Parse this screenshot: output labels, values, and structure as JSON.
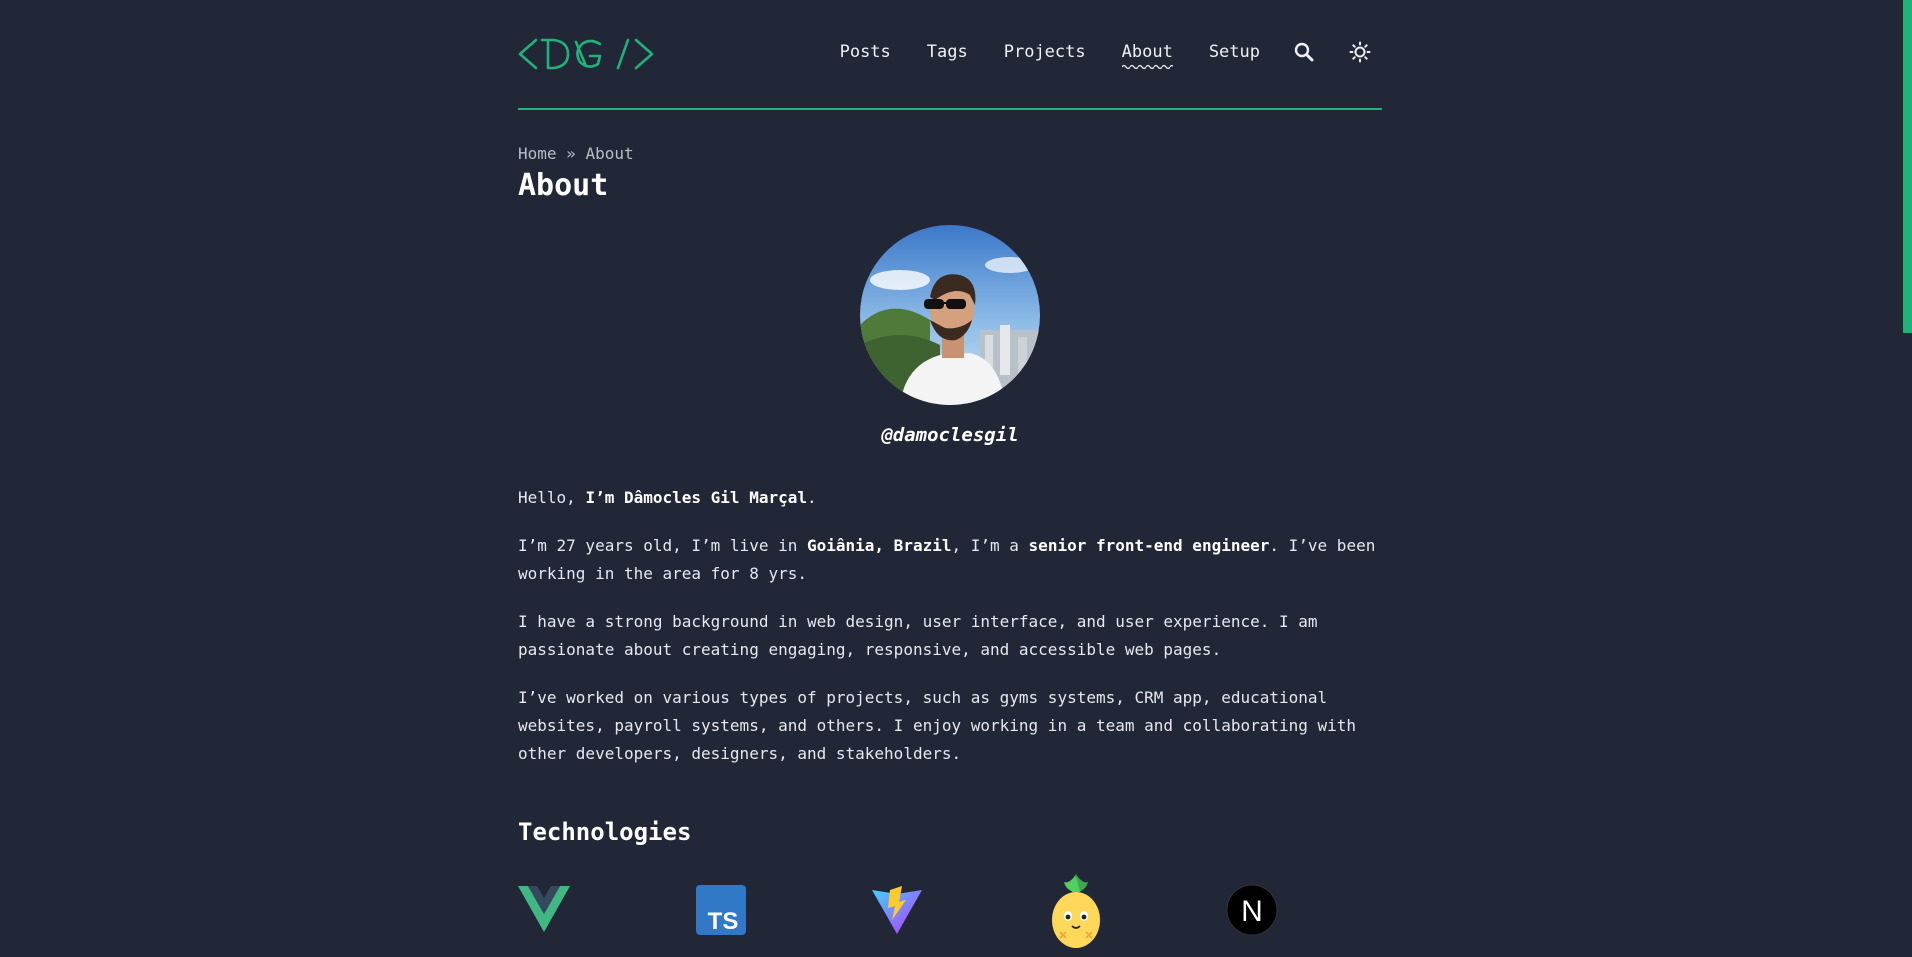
{
  "header": {
    "logo_text": "<DG/>",
    "nav": [
      {
        "label": "Posts"
      },
      {
        "label": "Tags"
      },
      {
        "label": "Projects"
      },
      {
        "label": "About"
      },
      {
        "label": "Setup"
      }
    ],
    "active_nav": "About",
    "accent_color": "#1fb27a"
  },
  "breadcrumb": {
    "home": "Home",
    "separator": "»",
    "current": "About"
  },
  "page": {
    "title": "About",
    "handle": "@damoclesgil"
  },
  "content": {
    "p1": {
      "a": "Hello, ",
      "b": "I’m Dâmocles Gil Marçal",
      "c": "."
    },
    "p2": {
      "a": "I’m 27 years old, I’m live in ",
      "b": "Goiânia, Brazil",
      "c": ", I’m a ",
      "d": "senior front-end engineer",
      "e": ". I’ve been working in the area for 8 yrs."
    },
    "p3": "I have a strong background in web design, user interface, and user experience. I am passionate about creating engaging, responsive, and accessible web pages.",
    "p4": "I’ve worked on various types of projects, such as gyms systems, CRM app, educational websites, payroll systems, and others. I enjoy working in a team and collaborating with other developers, designers, and stakeholders."
  },
  "technologies": {
    "title": "Technologies",
    "items": [
      {
        "icon": "vue-icon"
      },
      {
        "icon": "typescript-icon",
        "text": "TS"
      },
      {
        "icon": "vite-icon"
      },
      {
        "icon": "pinia-icon"
      },
      {
        "icon": "nextjs-icon",
        "text": "N"
      }
    ]
  },
  "colors": {
    "background": "#222737",
    "accent": "#1fb27a",
    "text": "#e6e8ee"
  }
}
